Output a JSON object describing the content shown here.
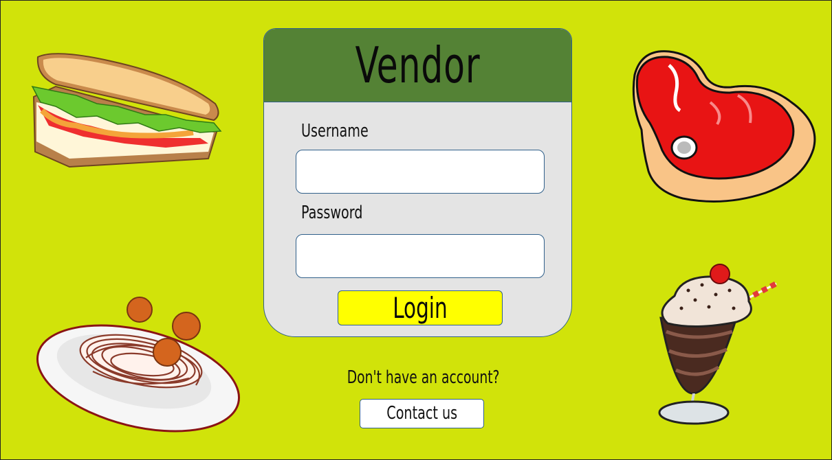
{
  "login_card": {
    "title": "Vendor",
    "username_label": "Username",
    "username_value": "",
    "password_label": "Password",
    "password_value": "",
    "login_label": "Login"
  },
  "signup": {
    "prompt": "Don't have an account?",
    "contact_label": "Contact us"
  },
  "decorations": [
    "sandwich-image",
    "steak-image",
    "spaghetti-image",
    "milkshake-image"
  ],
  "colors": {
    "background": "#d1e30a",
    "header": "#548235",
    "card": "#e4e4e4",
    "login_button": "#ffff00",
    "border": "#2f5f8a"
  }
}
